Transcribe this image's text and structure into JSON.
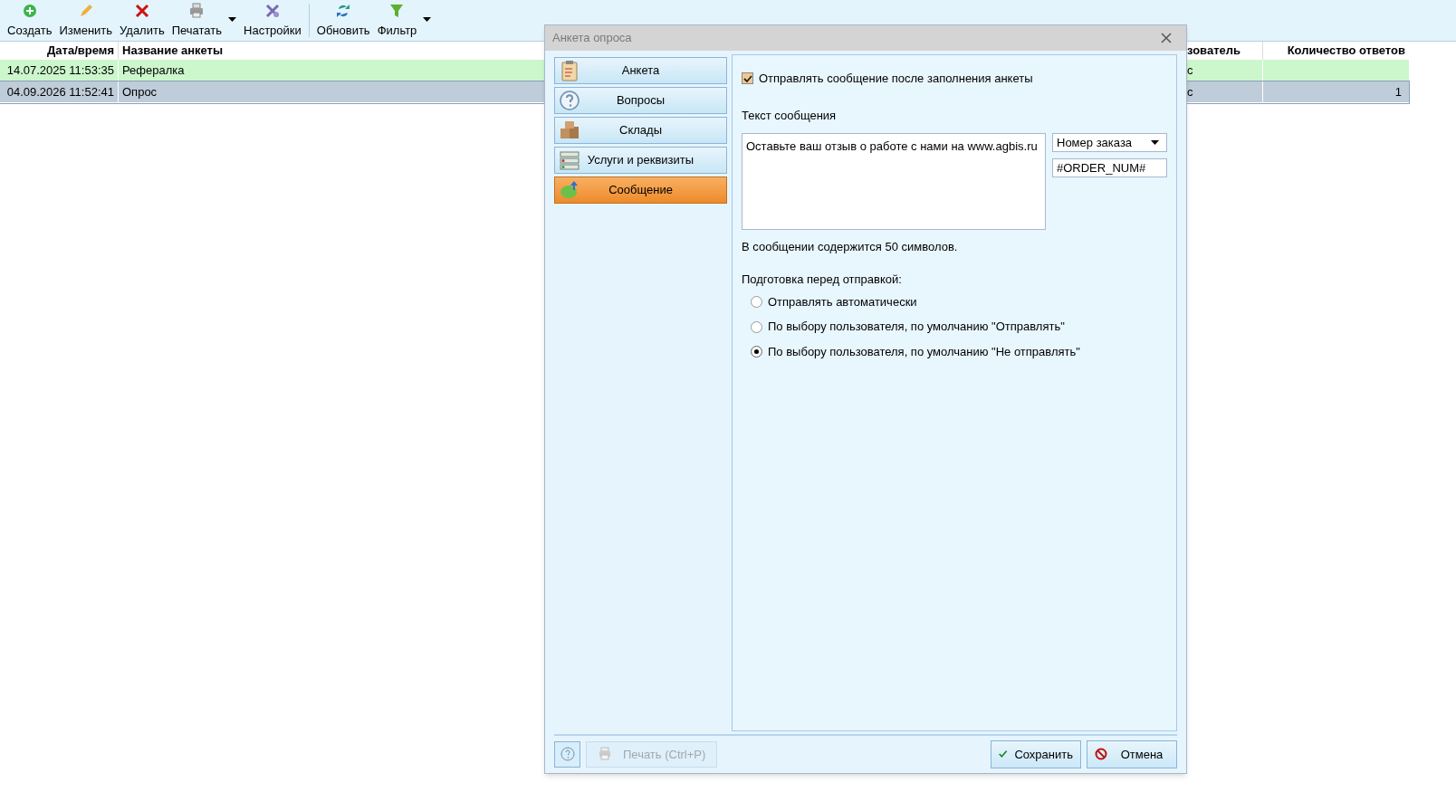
{
  "toolbar": [
    {
      "label": "Создать",
      "kind": "create",
      "menu": false
    },
    {
      "label": "Изменить",
      "kind": "edit",
      "menu": false
    },
    {
      "label": "Удалить",
      "kind": "delete",
      "menu": false
    },
    {
      "label": "Печатать",
      "kind": "print",
      "menu": true
    },
    {
      "label": "Настройки",
      "kind": "settings",
      "menu": false
    },
    {
      "label": "Обновить",
      "kind": "refresh",
      "menu": false
    },
    {
      "label": "Фильтр",
      "kind": "filter",
      "menu": true
    }
  ],
  "table": {
    "columns": [
      "Дата/время",
      "Название анкеты",
      "зователь",
      "Количество ответов"
    ],
    "rows": [
      {
        "cells": [
          "14.07.2025 11:53:35",
          "Рефералка",
          "с",
          ""
        ],
        "selected": false,
        "color": "#ccf7cc"
      },
      {
        "cells": [
          "04.09.2026 11:52:41",
          "Опрос",
          "с",
          "1"
        ],
        "selected": true,
        "color": "#bfccd9"
      }
    ]
  },
  "dialog": {
    "title": "Анкета опроса",
    "nav": [
      {
        "label": "Анкета",
        "kind": "form",
        "selected": false
      },
      {
        "label": "Вопросы",
        "kind": "question",
        "selected": false
      },
      {
        "label": "Склады",
        "kind": "boxes",
        "selected": false
      },
      {
        "label": "Услуги и реквизиты",
        "kind": "list",
        "selected": false
      },
      {
        "label": "Сообщение",
        "kind": "sms",
        "selected": true
      }
    ],
    "send_checkbox": {
      "label": "Отправлять сообщение после заполнения анкеты",
      "checked": true
    },
    "message_label": "Текст сообщения",
    "message_value": "Оставьте ваш отзыв о работе с нами на www.agbis.ru",
    "field_select": "Номер заказа",
    "field_code": "#ORDER_NUM#",
    "count_text": "В сообщении содержится 50 символов.",
    "prep_label": "Подготовка перед отправкой:",
    "options": [
      {
        "label": "Отправлять автоматически",
        "selected": false
      },
      {
        "label": "По выбору пользователя, по умолчанию \"Отправлять\"",
        "selected": false
      },
      {
        "label": "По выбору пользователя, по умолчанию \"Не отправлять\"",
        "selected": true
      }
    ],
    "print_button": {
      "label": "Печать (Ctrl+P)",
      "disabled": true
    },
    "save_button": "Сохранить",
    "cancel_button": "Отмена"
  }
}
